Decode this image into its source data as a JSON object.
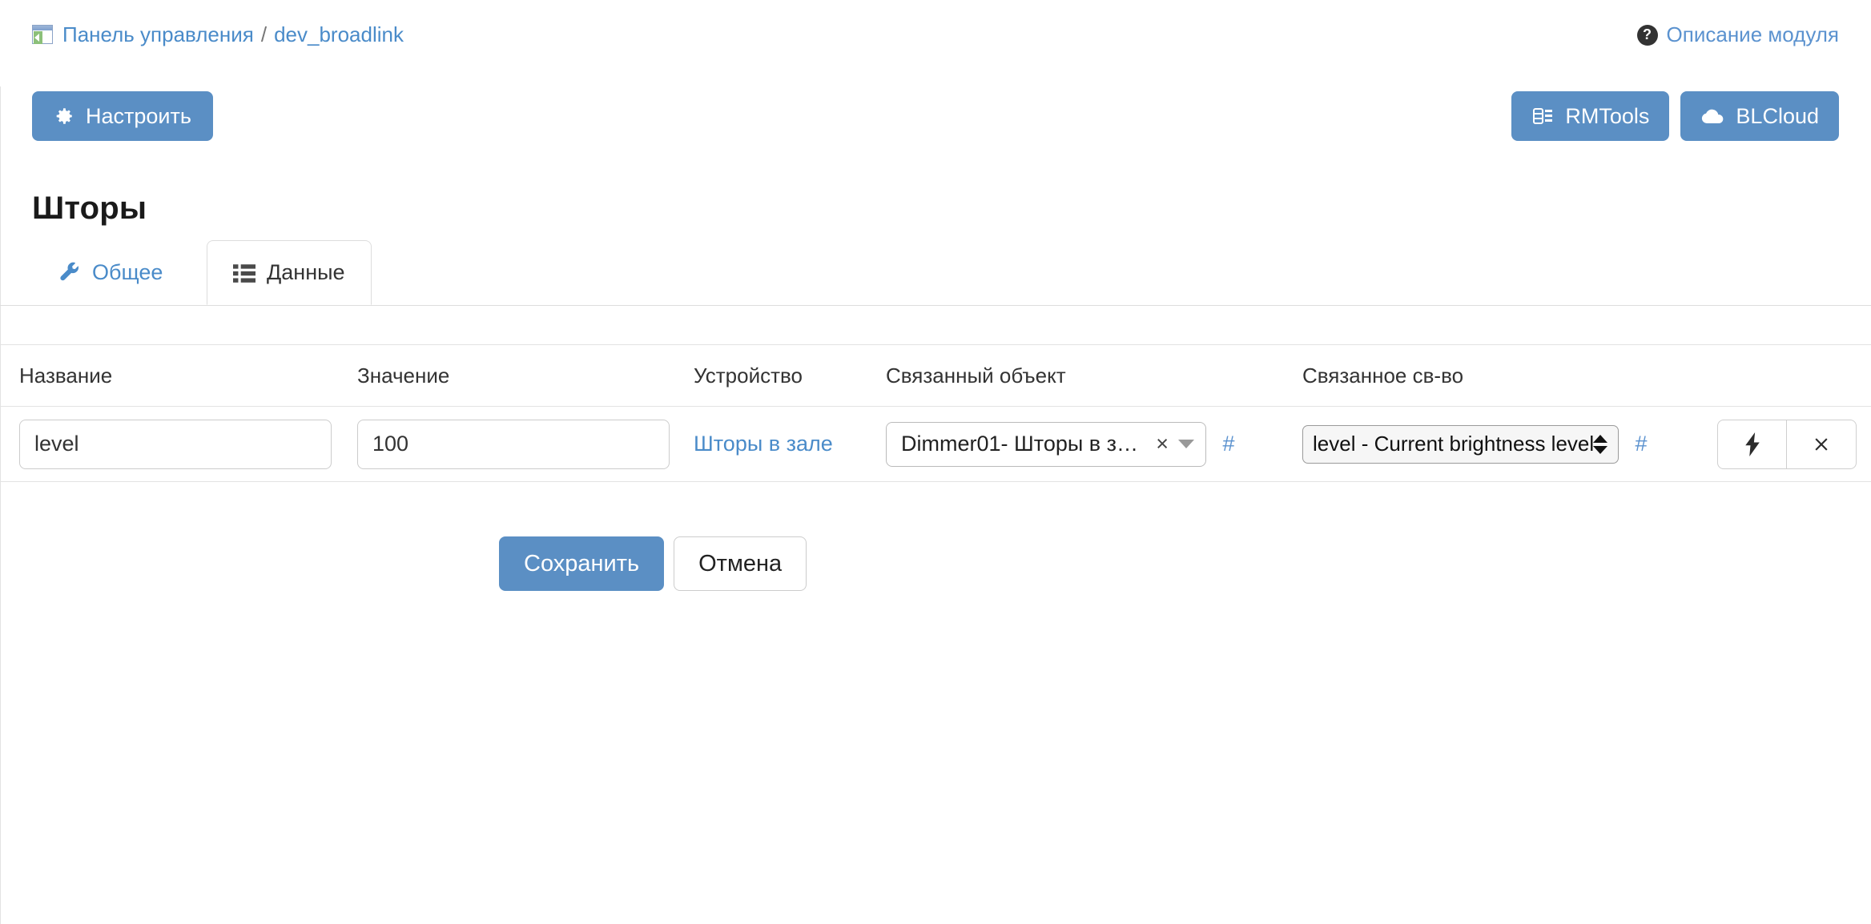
{
  "breadcrumb": {
    "icon": "window-back-icon",
    "home_label": "Панель управления",
    "separator": "/",
    "current_label": "dev_broadlink"
  },
  "header": {
    "module_description_label": "Описание модуля",
    "module_description_icon": "question-circle-icon"
  },
  "toolbar": {
    "configure_label": "Настроить",
    "configure_icon": "gear-icon",
    "rmtools_label": "RMTools",
    "rmtools_icon": "remote-signal-icon",
    "blcloud_label": "BLCloud",
    "blcloud_icon": "cloud-icon"
  },
  "page": {
    "title": "Шторы"
  },
  "tabs": [
    {
      "label": "Общее",
      "icon": "wrench-icon",
      "active": false
    },
    {
      "label": "Данные",
      "icon": "list-icon",
      "active": true
    }
  ],
  "table": {
    "columns": [
      "Название",
      "Значение",
      "Устройство",
      "Связанный объект",
      "Связанное св-во"
    ],
    "rows": [
      {
        "name_value": "level",
        "name_placeholder": "Название",
        "value_value": "100",
        "value_placeholder": "Значение",
        "device_label": "Шторы в зале",
        "linked_object": "Dimmer01- Шторы в з…",
        "linked_object_clear": "×",
        "linked_object_hash": "#",
        "linked_property": "level - Current brightness level",
        "linked_property_hash": "#",
        "action_run_icon": "lightning-bolt-icon",
        "action_delete_icon": "times-icon"
      }
    ]
  },
  "footer": {
    "save_label": "Сохранить",
    "cancel_label": "Отмена"
  },
  "colors": {
    "primary": "#5b8fc4",
    "link": "#4a8bc9",
    "border": "#e3e3e3",
    "text": "#333333"
  }
}
